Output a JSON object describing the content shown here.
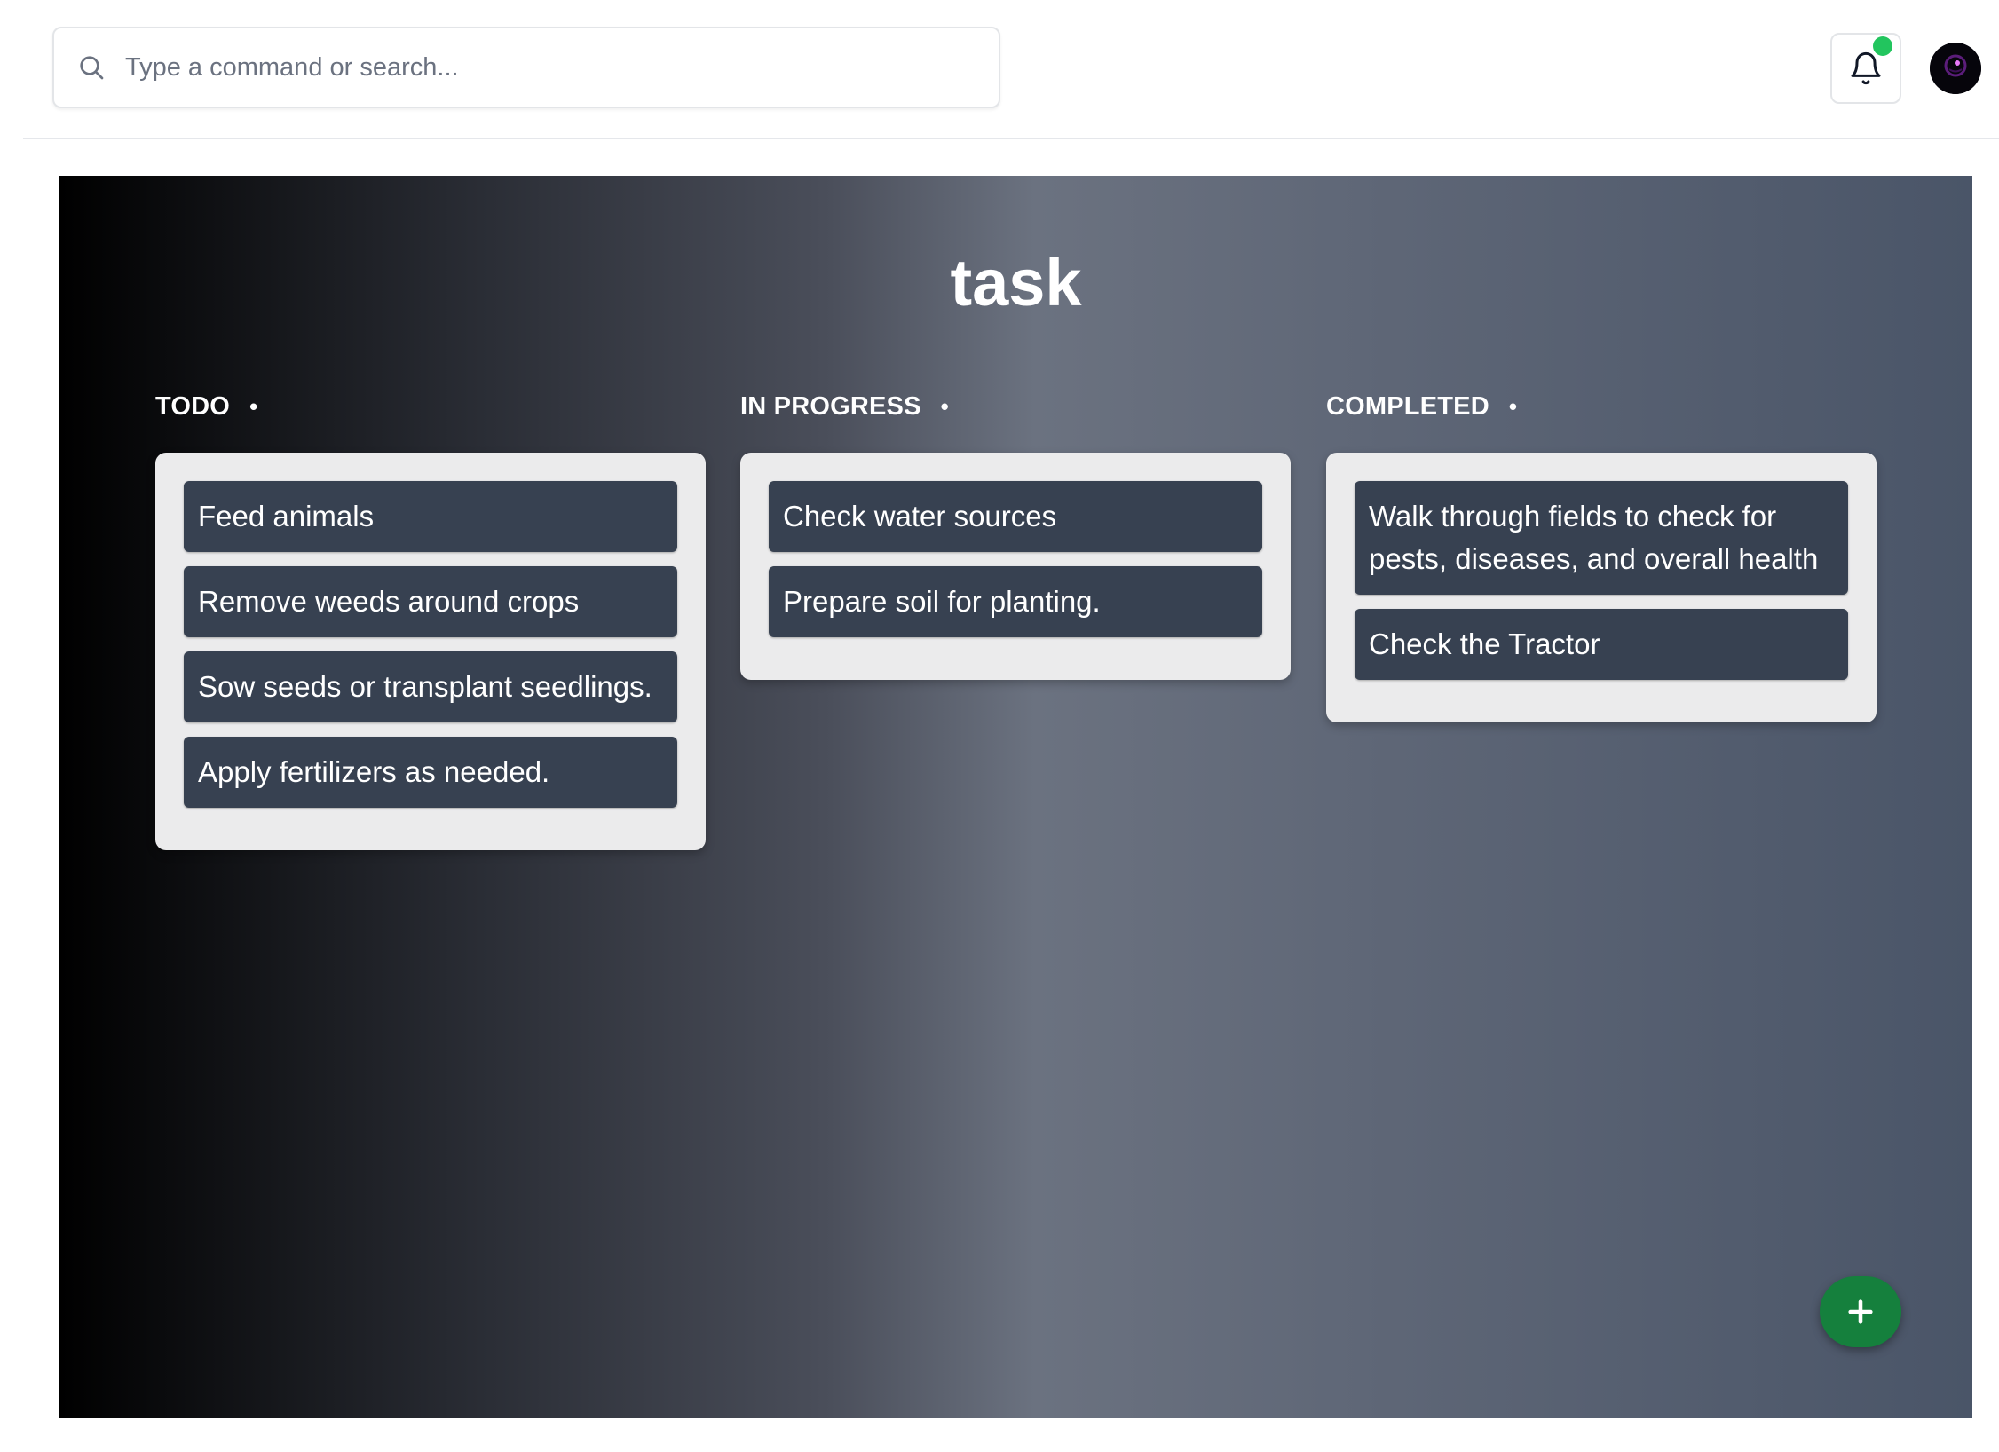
{
  "search": {
    "placeholder": "Type a command or search..."
  },
  "colors": {
    "notification_dot": "#22c55e",
    "fab": "#15803d",
    "card": "#374151",
    "panel": "#ebebec"
  },
  "board": {
    "title": "task",
    "columns": [
      {
        "title": "TODO",
        "bullet": "•",
        "cards": [
          "Feed animals",
          "Remove weeds around crops",
          "Sow seeds or transplant seedlings.",
          "Apply fertilizers as needed."
        ]
      },
      {
        "title": "IN PROGRESS",
        "bullet": "•",
        "cards": [
          "Check water sources",
          "Prepare soil for planting."
        ]
      },
      {
        "title": "COMPLETED",
        "bullet": "•",
        "cards": [
          "Walk through fields to check for pests, diseases, and overall health",
          "Check the Tractor"
        ]
      }
    ]
  },
  "fab": {
    "label": "+"
  }
}
